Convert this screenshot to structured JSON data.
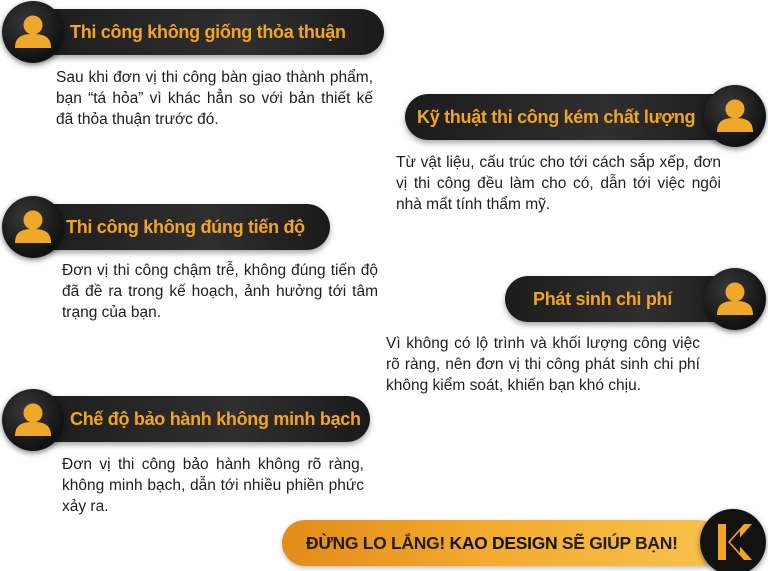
{
  "items": [
    {
      "title": "Thi công không giống thỏa thuận",
      "description": "Sau khi đơn vị thi công bàn giao thành phẩm, bạn “tá hỏa” vì khác hẳn so với bản thiết kế đã thỏa thuận trước đó.",
      "icon": "user-icon"
    },
    {
      "title": "Kỹ thuật thi công kém chất lượng",
      "description": "Từ vật liệu, cấu trúc cho tới cách sắp xếp, đơn vị thi công đều làm cho có, dẫn tới việc ngôi nhà mất tính thẩm mỹ.",
      "icon": "user-icon"
    },
    {
      "title": "Thi công không đúng tiến độ",
      "description": "Đơn vị thi công chậm trễ, không đúng tiến độ đã đề ra trong kế hoạch, ảnh hưởng tới tâm trạng của bạn.",
      "icon": "user-icon"
    },
    {
      "title": "Phát sinh chi phí",
      "description": "Vì không có lộ trình và khối lượng công việc rõ ràng, nên đơn vị thi công phát sinh chi phí không kiểm soát, khiến bạn khó chịu.",
      "icon": "user-icon"
    },
    {
      "title": "Chế độ bảo hành không minh bạch",
      "description": "Đơn vị thi công bảo hành không rõ ràng, không minh bạch, dẫn tới nhiều phiền phức xảy ra.",
      "icon": "user-icon"
    }
  ],
  "cta": {
    "part1": "ĐỪNG LO LẮNG! ",
    "brand": "KAO DESIGN",
    "part2": " SẼ GIÚP BẠN!",
    "logo_icon": "kao-design-logo-icon"
  },
  "colors": {
    "pill_dark": "#1c1c1c",
    "title_orange": "#f3a521",
    "cta_orange": "#f3a92d",
    "avatar_gold": "#f0a82a"
  }
}
